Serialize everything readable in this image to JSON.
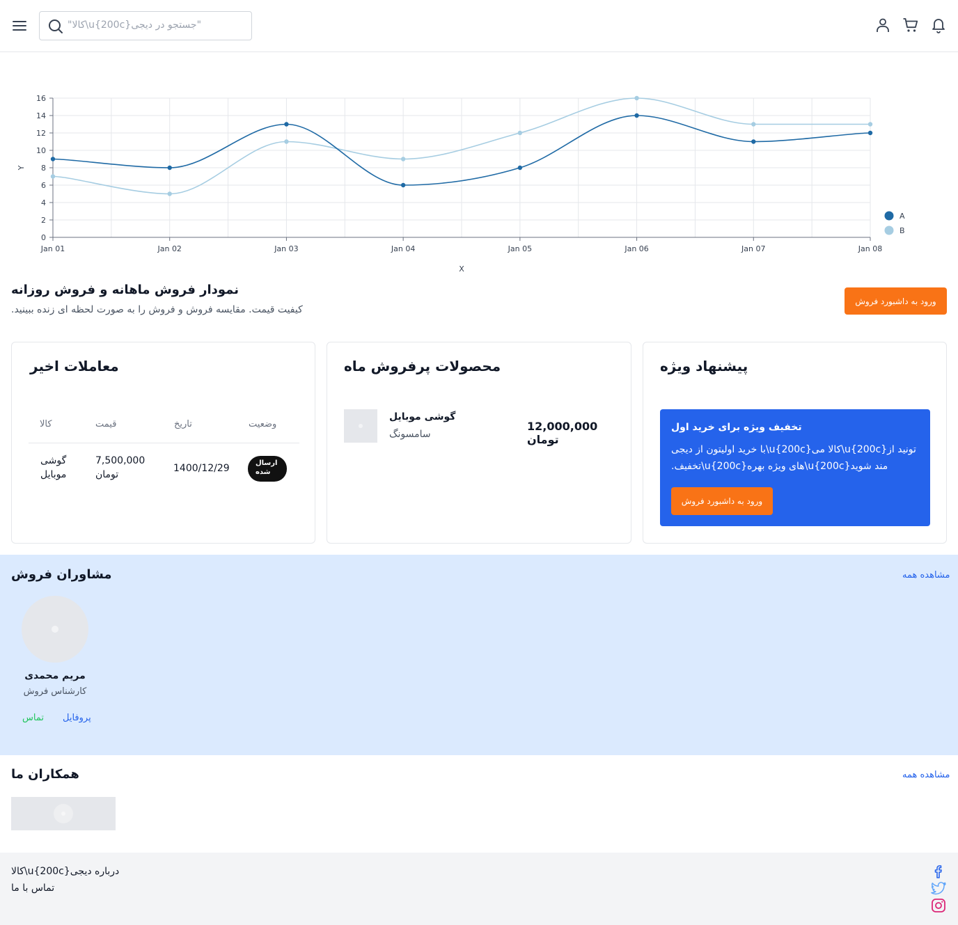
{
  "header": {
    "search_placeholder": "جستجو در دیجی\\u{200c}کالا\"",
    "search_display": "\"کالا\\u{200c}جستجو در دیجی\"",
    "icons": [
      "menu-icon",
      "search-icon",
      "user-icon",
      "cart-icon",
      "bell-icon"
    ]
  },
  "chart_data": {
    "type": "line",
    "x": [
      "Jan 01",
      "Jan 02",
      "Jan 03",
      "Jan 04",
      "Jan 05",
      "Jan 06",
      "Jan 07",
      "Jan 08"
    ],
    "series": [
      {
        "name": "A",
        "color": "#1f6aa5",
        "values": [
          9,
          8,
          13,
          6,
          8,
          14,
          11,
          12
        ]
      },
      {
        "name": "B",
        "color": "#a6cde2",
        "values": [
          7,
          5,
          11,
          9,
          12,
          16,
          13,
          13
        ]
      }
    ],
    "xlabel": "X",
    "ylabel": "Y",
    "ylim": [
      0,
      16
    ],
    "yticks": [
      "0",
      "2",
      "4",
      "6",
      "8",
      "10",
      "12",
      "14",
      "16"
    ],
    "grid": true,
    "legend_position": "right"
  },
  "hero": {
    "title": "نمودار فروش ماهانه و فروش روزانه",
    "subtitle": ".کیفیت قیمت. مقایسه فروش و فروش را به صورت لحظه ای زنده ببینید",
    "button_label": "ورود به داشبورد فروش"
  },
  "transactions": {
    "title": "معاملات اخیر",
    "headers": {
      "item": "کالا",
      "price": "قیمت",
      "date": "تاریخ",
      "status": "وضعیت"
    },
    "row": {
      "item_line1": "گوشی",
      "item_line2": "موبایل",
      "price_line1": "7,500,000",
      "price_line2": "تومان",
      "date": "1400/12/29",
      "status_line1": "ارسال",
      "status_line2": "شده"
    }
  },
  "bestsellers": {
    "title": "محصولات پرفروش ماه",
    "product_name": "گوشی موبایل",
    "brand": "سامسونگ",
    "price": "12,000,000 تومان"
  },
  "offer": {
    "title": "پیشنهاد ویژه",
    "box_title": "تخفیف ویژه برای خرید اول",
    "box_text_line1": "با خرید اولیتون از دیجی\\u{200c}کالا می\\u{200c}تونید از",
    "box_text_line2": ".تخفیف\\u{200c}های ویژه بهره\\u{200c}مند شوید",
    "button_label": "ورود به داشبورد فروش"
  },
  "advisors": {
    "title": "مشاوران فروش",
    "see_all": "مشاهده همه",
    "name": "مریم محمدی",
    "role": "کارشناس فروش",
    "profile_link": "پروفایل",
    "contact_link": "تماس",
    "contact_color": "#22c55e"
  },
  "partners": {
    "title": "همکاران ما",
    "see_all": "مشاهده همه"
  },
  "footer": {
    "about": "درباره دیجی\\u{200c}کالا",
    "about_display": "کالا\\u{200c}درباره دیجی",
    "contact": "تماس با ما",
    "social": [
      "facebook-icon",
      "twitter-icon",
      "instagram-icon"
    ]
  },
  "colors": {
    "accent": "#f97316",
    "primary": "#2563eb",
    "advisors_bg": "#dbeafe"
  }
}
